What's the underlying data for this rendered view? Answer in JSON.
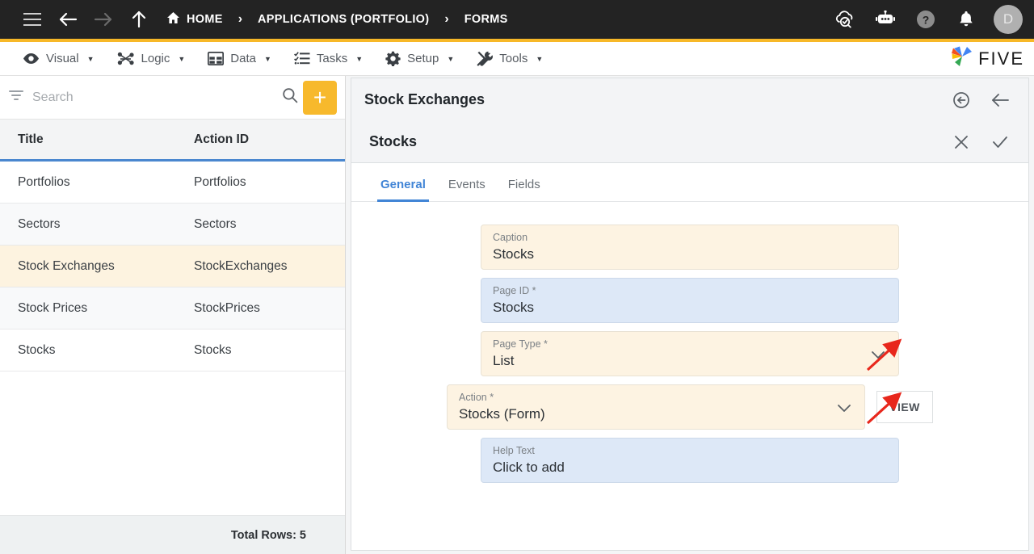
{
  "topbar": {
    "menu_icon": "hamburger-icon",
    "back_icon": "arrow-left-icon",
    "forward_icon": "arrow-right-icon",
    "up_icon": "arrow-up-icon",
    "breadcrumbs": [
      {
        "label": "HOME",
        "icon": "home-icon"
      },
      {
        "label": "APPLICATIONS (PORTFOLIO)",
        "icon": ""
      },
      {
        "label": "FORMS",
        "icon": ""
      }
    ],
    "separator": "›",
    "right_icons": [
      "cloud-check-icon",
      "robot-icon",
      "help-icon",
      "bell-icon"
    ],
    "avatar_initial": "D"
  },
  "accent_color": "#f7b828",
  "menubar": {
    "items": [
      {
        "label": "Visual",
        "icon": "eye-icon"
      },
      {
        "label": "Logic",
        "icon": "flow-nodes-icon"
      },
      {
        "label": "Data",
        "icon": "table-grid-icon"
      },
      {
        "label": "Tasks",
        "icon": "checklist-icon"
      },
      {
        "label": "Setup",
        "icon": "gear-icon"
      },
      {
        "label": "Tools",
        "icon": "tools-icon"
      }
    ],
    "caret": "▼",
    "logo_text": "FIVE"
  },
  "sidebar": {
    "search": {
      "placeholder": "Search",
      "value": "",
      "filter_icon": "filter-icon",
      "search_icon": "search-icon"
    },
    "add_button_label": "+",
    "columns": [
      "Title",
      "Action ID"
    ],
    "rows": [
      {
        "title": "Portfolios",
        "action_id": "Portfolios"
      },
      {
        "title": "Sectors",
        "action_id": "Sectors"
      },
      {
        "title": "Stock Exchanges",
        "action_id": "StockExchanges"
      },
      {
        "title": "Stock Prices",
        "action_id": "StockPrices"
      },
      {
        "title": "Stocks",
        "action_id": "Stocks"
      }
    ],
    "selected_index": 2,
    "total_rows_label": "Total Rows: 5"
  },
  "record": {
    "header_title": "Stock Exchanges",
    "header_icons": [
      "revert-circle-icon",
      "arrow-left-icon"
    ],
    "sub_title": "Stocks",
    "sub_icons": [
      "close-icon",
      "check-icon"
    ],
    "tabs": [
      {
        "label": "General",
        "active": true
      },
      {
        "label": "Events",
        "active": false
      },
      {
        "label": "Fields",
        "active": false
      }
    ],
    "fields": [
      {
        "label": "Caption",
        "value": "Stocks",
        "style": "cream",
        "dropdown": false,
        "button": ""
      },
      {
        "label": "Page ID *",
        "value": "Stocks",
        "style": "blue",
        "dropdown": false,
        "button": ""
      },
      {
        "label": "Page Type *",
        "value": "List",
        "style": "cream",
        "dropdown": true,
        "button": ""
      },
      {
        "label": "Action *",
        "value": "Stocks (Form)",
        "style": "cream",
        "dropdown": true,
        "button": "VIEW"
      },
      {
        "label": "Help Text",
        "value": "Click to add",
        "style": "blue",
        "dropdown": false,
        "button": ""
      }
    ],
    "annotation_color": "#e8271c",
    "annotation_count": 2
  }
}
